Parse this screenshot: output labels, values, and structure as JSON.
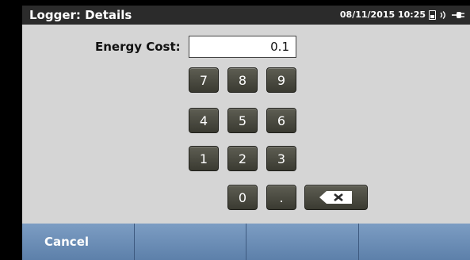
{
  "header": {
    "title": "Logger: Details",
    "datetime": "08/11/2015 10:25",
    "icons": [
      "sd-card-icon",
      "wireless-icon",
      "plug-icon"
    ]
  },
  "form": {
    "label": "Energy Cost:",
    "value": "0.1"
  },
  "keypad": {
    "k7": "7",
    "k8": "8",
    "k9": "9",
    "k4": "4",
    "k5": "5",
    "k6": "6",
    "k1": "1",
    "k2": "2",
    "k3": "3",
    "k0": "0",
    "dot": ".",
    "backspace_icon": "backspace-icon"
  },
  "softkeys": {
    "f1": "Cancel",
    "f2": "",
    "f3": "",
    "f4": ""
  },
  "colors": {
    "title_bar": "#2b2b2b",
    "content_bg": "#d5d5d5",
    "key_bg": "#4a4a40",
    "softkey_bg": "#6f8fb8"
  }
}
